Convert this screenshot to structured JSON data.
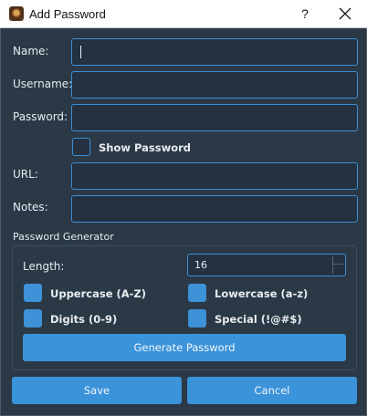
{
  "window": {
    "title": "Add Password",
    "help_label": "?",
    "icons": {
      "app": "app-icon",
      "close": "close-icon"
    }
  },
  "form": {
    "name_label": "Name:",
    "name_value": "",
    "username_label": "Username:",
    "username_value": "",
    "password_label": "Password:",
    "password_value": "",
    "show_password_label": "Show Password",
    "show_password_checked": false,
    "url_label": "URL:",
    "url_value": "",
    "notes_label": "Notes:",
    "notes_value": ""
  },
  "generator": {
    "section_title": "Password Generator",
    "length_label": "Length:",
    "length_value": "16",
    "options": [
      {
        "label": "Uppercase (A-Z)",
        "checked": true
      },
      {
        "label": "Lowercase (a-z)",
        "checked": true
      },
      {
        "label": "Digits (0-9)",
        "checked": true
      },
      {
        "label": "Special (!@#$)",
        "checked": true
      }
    ],
    "generate_label": "Generate Password"
  },
  "actions": {
    "save_label": "Save",
    "cancel_label": "Cancel"
  },
  "colors": {
    "background": "#2b3947",
    "field_bg": "#233140",
    "accent": "#3b93da",
    "field_border": "#3d8fd4",
    "title_bar": "#ffffff"
  }
}
